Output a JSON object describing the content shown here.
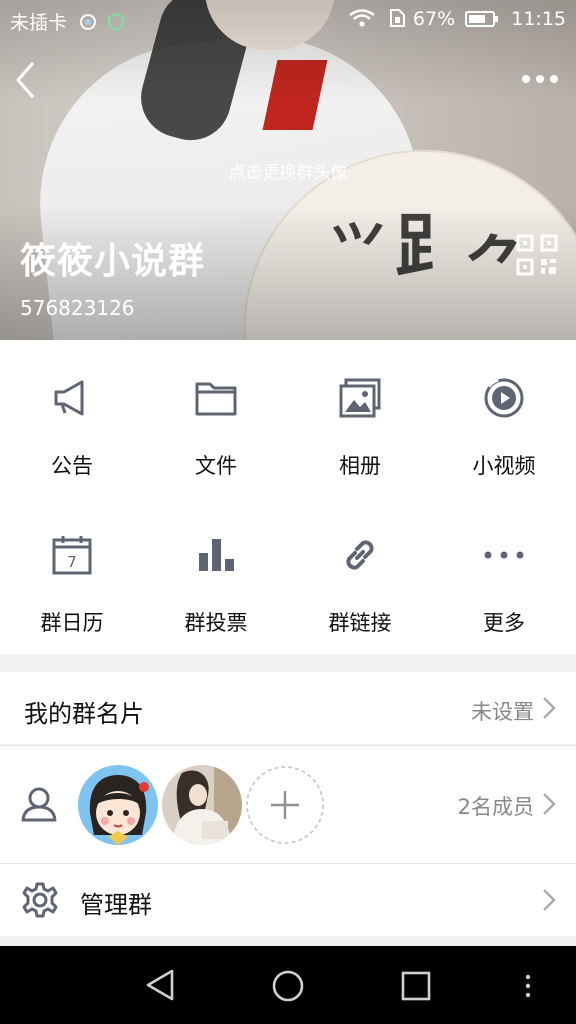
{
  "status_bar": {
    "carrier": "未插卡",
    "battery": "67%",
    "time": "11:15"
  },
  "hero": {
    "change_avatar_hint": "点击更换群头像",
    "group_name": "筱筱小说群",
    "group_id": "576823126"
  },
  "features": [
    {
      "label": "公告",
      "icon": "megaphone-icon"
    },
    {
      "label": "文件",
      "icon": "folder-icon"
    },
    {
      "label": "相册",
      "icon": "album-icon"
    },
    {
      "label": "小视频",
      "icon": "video-icon"
    },
    {
      "label": "群日历",
      "icon": "calendar-icon"
    },
    {
      "label": "群投票",
      "icon": "bar-chart-icon"
    },
    {
      "label": "群链接",
      "icon": "link-icon"
    },
    {
      "label": "更多",
      "icon": "more-dots-icon"
    }
  ],
  "calendar_day": "7",
  "card": {
    "label": "我的群名片",
    "value": "未设置"
  },
  "members": {
    "count_label": "2名成员"
  },
  "manage": {
    "label": "管理群"
  },
  "colors": {
    "icon_gray": "#5f6472",
    "text_gray": "#888888"
  }
}
